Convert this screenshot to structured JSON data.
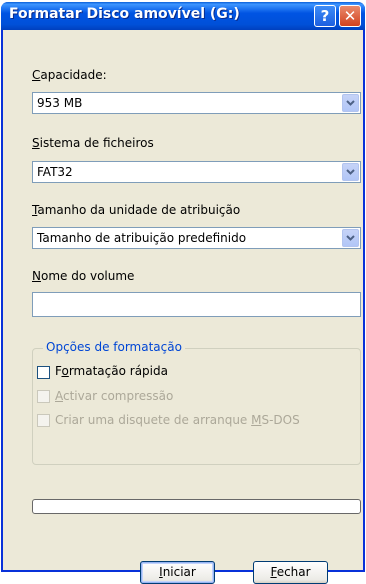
{
  "window": {
    "title": "Formatar Disco amovível (G:)",
    "help_button": "?",
    "close_button": "✕"
  },
  "capacity": {
    "label_accel": "C",
    "label_rest": "apacidade:",
    "value": "953 MB"
  },
  "filesystem": {
    "label_accel": "S",
    "label_rest": "istema de ficheiros",
    "value": "FAT32"
  },
  "allocation": {
    "label_accel": "T",
    "label_rest": "amanho da unidade de atribuição",
    "value": "Tamanho de atribuição predefinido"
  },
  "volume": {
    "label_accel": "N",
    "label_rest": "ome do volume",
    "value": ""
  },
  "format_options": {
    "title": "Opções de formatação",
    "quick": {
      "pre": "F",
      "accel": "o",
      "post": "rmatação rápida",
      "checked": false,
      "enabled": true
    },
    "compress": {
      "pre": "",
      "accel": "A",
      "post": "ctivar compressão",
      "checked": false,
      "enabled": false
    },
    "msdos": {
      "pre": "Criar uma disquete de arranque ",
      "accel": "M",
      "post": "S-DOS",
      "checked": false,
      "enabled": false
    }
  },
  "progress": {
    "value": 0
  },
  "buttons": {
    "start": {
      "accel": "I",
      "rest": "niciar"
    },
    "close": {
      "accel": "F",
      "rest": "echar"
    }
  },
  "colors": {
    "titlebar": "#0054e3",
    "window_face": "#ece9d8",
    "group_title": "#0046d5",
    "close_red": "#d3421f"
  }
}
